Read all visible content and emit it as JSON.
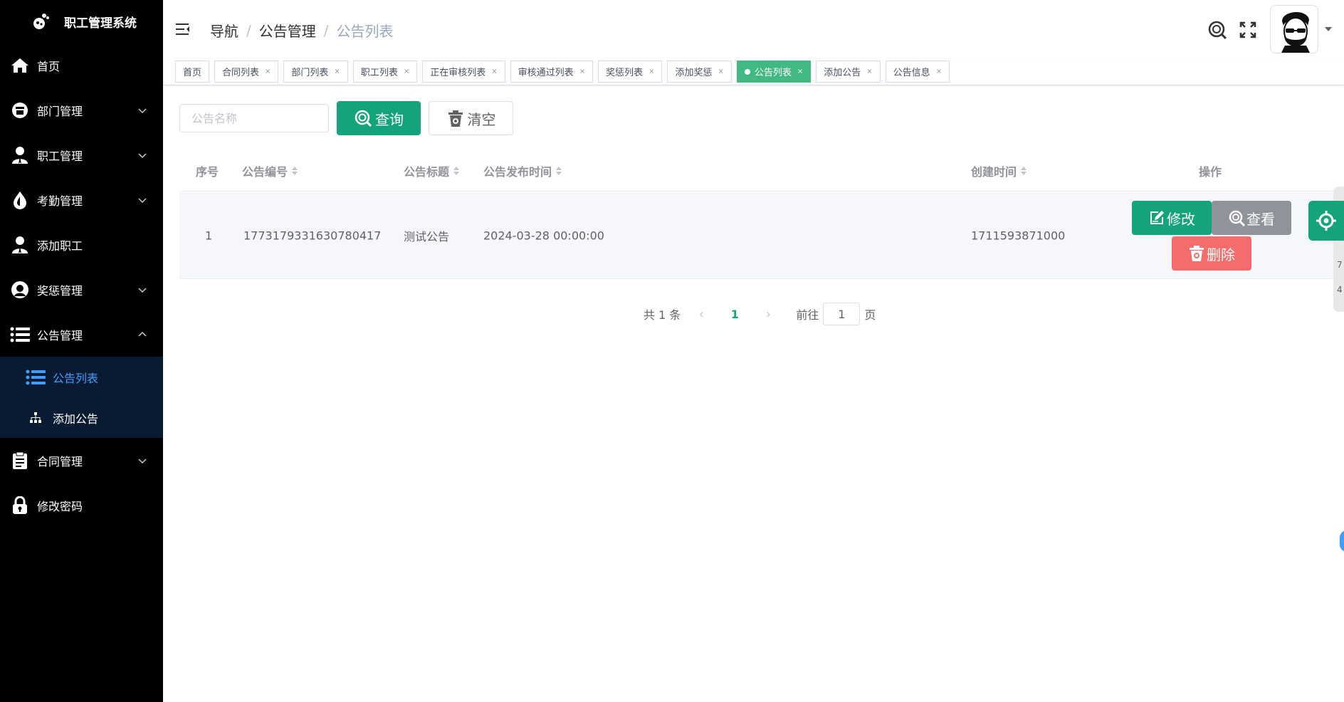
{
  "sidebar": {
    "app_title": "职工管理系统",
    "items": [
      {
        "label": "首页",
        "icon": "home-icon"
      },
      {
        "label": "部门管理",
        "icon": "department-icon"
      },
      {
        "label": "职工管理",
        "icon": "employee-icon"
      },
      {
        "label": "考勤管理",
        "icon": "attendance-icon"
      },
      {
        "label": "添加职工",
        "icon": "add-employee-icon"
      },
      {
        "label": "奖惩管理",
        "icon": "reward-icon"
      },
      {
        "label": "公告管理",
        "icon": "list-icon"
      },
      {
        "label": "合同管理",
        "icon": "contract-icon"
      },
      {
        "label": "修改密码",
        "icon": "lock-icon"
      }
    ],
    "submenu": [
      {
        "label": "公告列表",
        "icon": "list-icon"
      },
      {
        "label": "添加公告",
        "icon": "sitemap-icon"
      }
    ]
  },
  "header": {
    "breadcrumb": [
      "导航",
      "公告管理",
      "公告列表"
    ],
    "separator": "/"
  },
  "tags": [
    {
      "label": "首页",
      "closable": false
    },
    {
      "label": "合同列表",
      "closable": true
    },
    {
      "label": "部门列表",
      "closable": true
    },
    {
      "label": "职工列表",
      "closable": true
    },
    {
      "label": "正在审核列表",
      "closable": true
    },
    {
      "label": "审核通过列表",
      "closable": true
    },
    {
      "label": "奖惩列表",
      "closable": true
    },
    {
      "label": "添加奖惩",
      "closable": true
    },
    {
      "label": "公告列表",
      "closable": true,
      "active": true
    },
    {
      "label": "添加公告",
      "closable": true
    },
    {
      "label": "公告信息",
      "closable": true
    }
  ],
  "tag_close_glyph": "×",
  "search": {
    "placeholder": "公告名称",
    "search_label": "查询",
    "clear_label": "清空"
  },
  "table": {
    "columns": [
      "序号",
      "公告编号",
      "公告标题",
      "公告发布时间",
      "创建时间",
      "操作"
    ],
    "rows": [
      {
        "index": "1",
        "code": "1773179331630780417",
        "title": "测试公告",
        "publish_time": "2024-03-28 00:00:00",
        "create_time": "1711593871000"
      }
    ],
    "actions": {
      "edit": "修改",
      "view": "查看",
      "delete": "删除"
    }
  },
  "pagination": {
    "total_text": "共 1 条",
    "current_page": "1",
    "goto_label": "前往",
    "goto_value": "1",
    "page_unit": "页"
  },
  "right_panel": {
    "text1": "7",
    "text2": "4"
  },
  "colors": {
    "sidebar_bg": "#000000",
    "submenu_bg": "#081b33",
    "primary": "#13a47b",
    "info": "#909399",
    "danger": "#f56c6c",
    "active_tag": "#42b983",
    "link": "#409eff"
  }
}
